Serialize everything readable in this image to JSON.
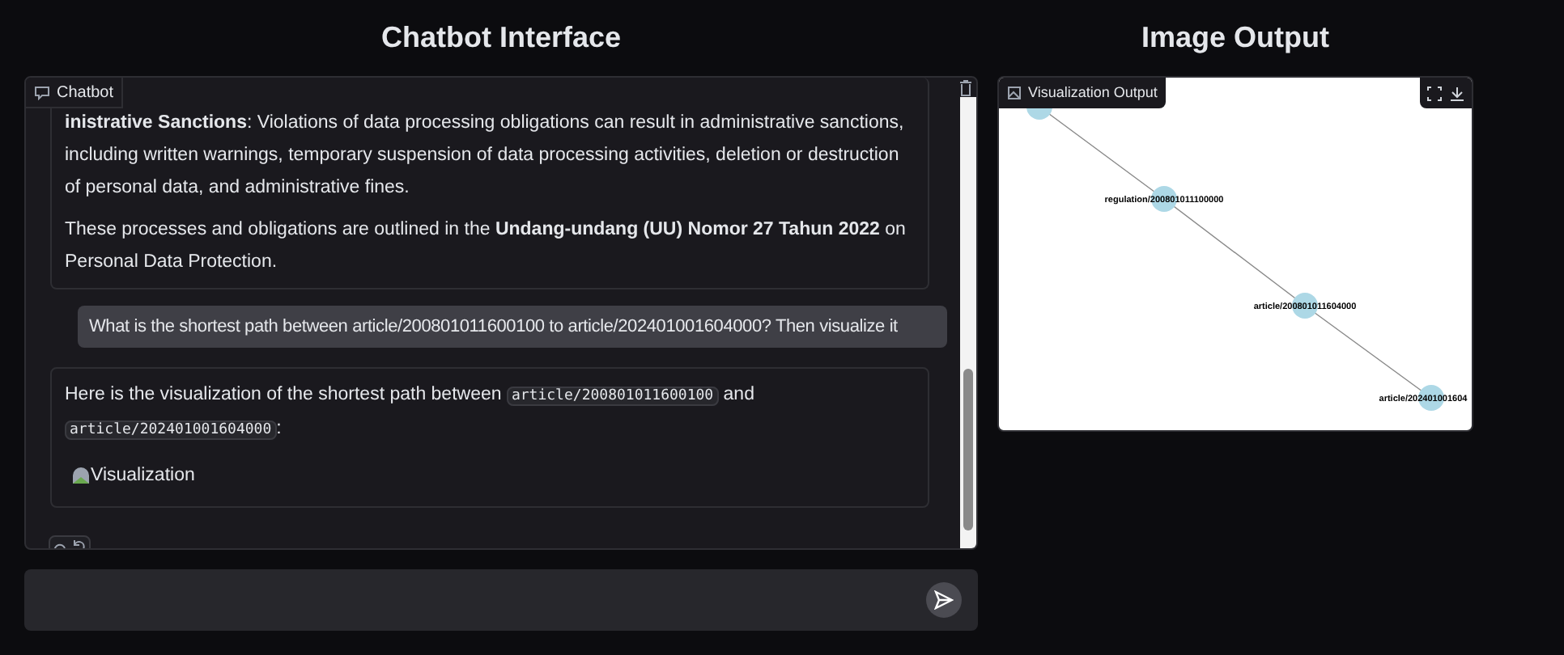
{
  "chat_title": "Chatbot Interface",
  "image_title": "Image Output",
  "chatbot": {
    "label": "Chatbot",
    "messages": [
      {
        "kind": "bot",
        "paragraphs": [
          [
            {
              "kind": "text",
              "text": "**inistrative Sanctions**: Violations of data processing obligations can result in administrative sanctions, including written warnings, temporary suspension of data processing activities, deletion or destruction of personal data, and administrative fines."
            }
          ],
          [
            {
              "kind": "text",
              "text": "These processes and obligations are outlined in the **Undang-undang (UU) Nomor 27 Tahun 2022** on Personal Data Protection."
            }
          ]
        ]
      },
      {
        "kind": "user",
        "paragraphs": [
          [
            {
              "kind": "text",
              "text": "What is the shortest path between article/200801011600100 to article/202401001604000? Then visualize it"
            }
          ]
        ]
      },
      {
        "kind": "bot",
        "paragraphs": [
          [
            {
              "kind": "text",
              "text": "Here is the visualization of the shortest path between "
            },
            {
              "kind": "code",
              "text": "article/200801011600100"
            },
            {
              "kind": "text",
              "text": " and "
            },
            {
              "kind": "code",
              "text": "article/202401001604000"
            },
            {
              "kind": "text",
              "text": ":"
            }
          ],
          [
            {
              "kind": "broken_image",
              "text": "Visualization"
            }
          ]
        ]
      }
    ]
  },
  "image_output": {
    "label": "Visualization Output",
    "graph_nodes": [
      {
        "label": "regulation/200801011100000"
      },
      {
        "label": "article/200801011604000"
      },
      {
        "label": "article/202401001604"
      }
    ]
  }
}
